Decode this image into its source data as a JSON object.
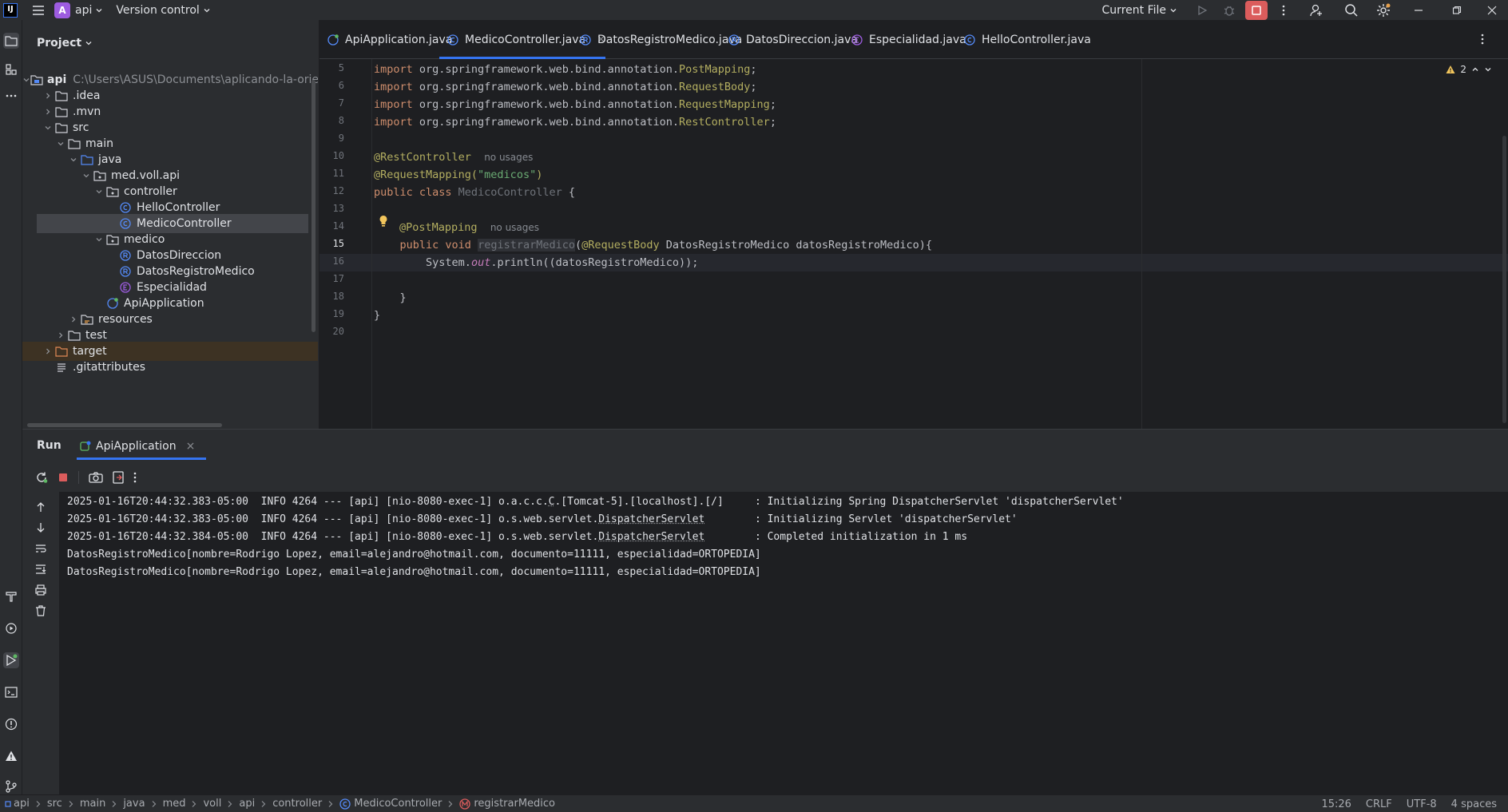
{
  "titlebar": {
    "app_logo_text": "IJ",
    "project_badge": "A",
    "project_name": "api",
    "vcs_label": "Version control",
    "run_config": "Current File"
  },
  "project_panel": {
    "title": "Project",
    "root_name": "api",
    "root_path": "C:\\Users\\ASUS\\Documents\\aplicando-la-orien",
    "items": [
      {
        "label": "api",
        "kind": "module",
        "level": 0,
        "expanded": true
      },
      {
        "label": ".idea",
        "kind": "folder",
        "level": 1,
        "expanded": false
      },
      {
        "label": ".mvn",
        "kind": "folder",
        "level": 1,
        "expanded": false
      },
      {
        "label": "src",
        "kind": "folder",
        "level": 1,
        "expanded": true
      },
      {
        "label": "main",
        "kind": "folder",
        "level": 2,
        "expanded": true
      },
      {
        "label": "java",
        "kind": "source-folder",
        "level": 3,
        "expanded": true
      },
      {
        "label": "med.voll.api",
        "kind": "package",
        "level": 4,
        "expanded": true
      },
      {
        "label": "controller",
        "kind": "package",
        "level": 5,
        "expanded": true
      },
      {
        "label": "HelloController",
        "kind": "class",
        "level": 6
      },
      {
        "label": "MedicoController",
        "kind": "class",
        "level": 6,
        "selected": true
      },
      {
        "label": "medico",
        "kind": "package",
        "level": 5,
        "expanded": true
      },
      {
        "label": "DatosDireccion",
        "kind": "record",
        "level": 6
      },
      {
        "label": "DatosRegistroMedico",
        "kind": "record",
        "level": 6
      },
      {
        "label": "Especialidad",
        "kind": "enum",
        "level": 6
      },
      {
        "label": "ApiApplication",
        "kind": "spring-class",
        "level": 5
      },
      {
        "label": "resources",
        "kind": "resources-folder",
        "level": 3,
        "expanded": false
      },
      {
        "label": "test",
        "kind": "folder",
        "level": 2,
        "expanded": false
      },
      {
        "label": "target",
        "kind": "excluded-folder",
        "level": 1,
        "expanded": false
      },
      {
        "label": ".gitattributes",
        "kind": "file",
        "level": 1
      }
    ]
  },
  "editor": {
    "tabs": [
      {
        "label": "ApiApplication.java",
        "icon": "spring-class-icon",
        "active": false
      },
      {
        "label": "MedicoController.java",
        "icon": "class-icon",
        "active": true,
        "close": "×"
      },
      {
        "label": "DatosRegistroMedico.java",
        "icon": "record-icon",
        "active": false
      },
      {
        "label": "DatosDireccion.java",
        "icon": "record-icon",
        "active": false
      },
      {
        "label": "Especialidad.java",
        "icon": "enum-icon",
        "active": false
      },
      {
        "label": "HelloController.java",
        "icon": "class-icon",
        "active": false
      }
    ],
    "warnings_count": "2",
    "current_line": "15",
    "line_numbers": [
      "5",
      "6",
      "7",
      "8",
      "9",
      "10",
      "11",
      "12",
      "13",
      "14",
      "15",
      "16",
      "17",
      "18",
      "19",
      "20"
    ],
    "code": {
      "l5_a": "import ",
      "l5_b": "org.springframework.web.bind.annotation.",
      "l5_c": "PostMapping",
      "l5_d": ";",
      "l6_a": "import ",
      "l6_b": "org.springframework.web.bind.annotation.",
      "l6_c": "RequestBody",
      "l6_d": ";",
      "l7_a": "import ",
      "l7_b": "org.springframework.web.bind.annotation.",
      "l7_c": "RequestMapping",
      "l7_d": ";",
      "l8_a": "import ",
      "l8_b": "org.springframework.web.bind.annotation.",
      "l8_c": "RestController",
      "l8_d": ";",
      "l10_ann": "@RestController",
      "l10_hint": "no usages",
      "l11_ann": "@RequestMapping(",
      "l11_str": "\"medicos\"",
      "l11_end": ")",
      "l12_kw": "public class ",
      "l12_cls": "MedicoController",
      "l12_end": " {",
      "l14_ann": "@PostMapping",
      "l14_hint": "no usages",
      "l15_kw": "public void ",
      "l15_fn": "registrarMedico",
      "l15_p1": "(",
      "l15_ann": "@RequestBody",
      "l15_rest": " DatosRegistroMedico datosRegistroMedico){",
      "l16_a": "System.",
      "l16_out": "out",
      "l16_b": ".println((datosRegistroMedico));",
      "l18": "}",
      "l19": "}"
    }
  },
  "run_panel": {
    "title": "Run",
    "tab_label": "ApiApplication",
    "tab_close": "×",
    "log": [
      {
        "a": "2025-01-16T20:44:32.383-05:00  INFO 4264 --- [api] [nio-8080-exec-1] o.a.c.c.",
        "u": "C",
        "b": ".[Tomcat-5].[localhost].[/]     : Initializing Spring DispatcherServlet 'dispatcherServlet'"
      },
      {
        "a": "2025-01-16T20:44:32.383-05:00  INFO 4264 --- [api] [nio-8080-exec-1] o.s.web.servlet.",
        "u": "DispatcherServlet",
        "b": "        : Initializing Servlet 'dispatcherServlet'"
      },
      {
        "a": "2025-01-16T20:44:32.384-05:00  INFO 4264 --- [api] [nio-8080-exec-1] o.s.web.servlet.",
        "u": "DispatcherServlet",
        "b": "        : Completed initialization in 1 ms"
      },
      {
        "a": "DatosRegistroMedico[nombre=Rodrigo Lopez, email=alejandro@hotmail.com, documento=11111, especialidad=ORTOPEDIA]",
        "u": "",
        "b": ""
      },
      {
        "a": "DatosRegistroMedico[nombre=Rodrigo Lopez, email=alejandro@hotmail.com, documento=11111, especialidad=ORTOPEDIA]",
        "u": "",
        "b": ""
      }
    ]
  },
  "statusbar": {
    "breadcrumbs": [
      "api",
      "src",
      "main",
      "java",
      "med",
      "voll",
      "api",
      "controller",
      "MedicoController",
      "registrarMedico"
    ],
    "position": "15:26",
    "line_sep": "CRLF",
    "encoding": "UTF-8",
    "indent": "4 spaces"
  },
  "colors": {
    "accent": "#3574f0",
    "stop_active": "#db5c5c",
    "project_badge": "#9d5ce0"
  }
}
